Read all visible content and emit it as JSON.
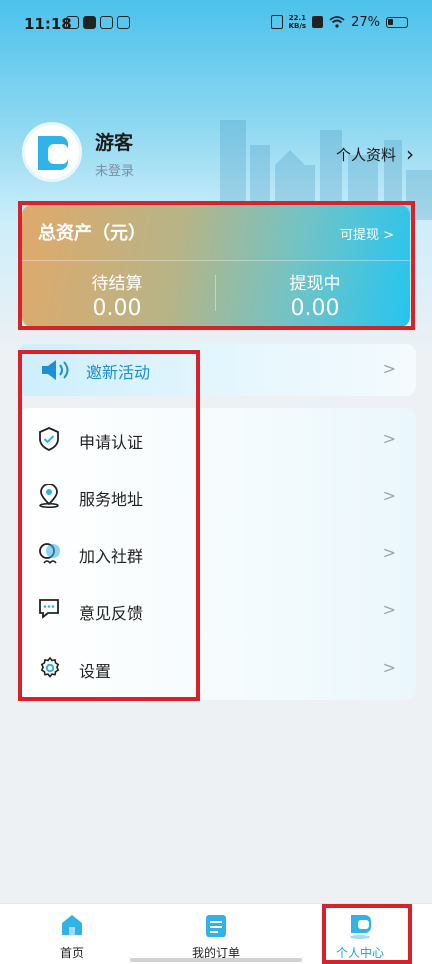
{
  "status_bar": {
    "time": "11:18",
    "net_speed_value": "22.1",
    "net_speed_unit": "KB/s",
    "battery": "27%"
  },
  "profile": {
    "username": "游客",
    "login_status": "未登录",
    "profile_link": "个人资料",
    "chevron": "›"
  },
  "assets": {
    "title": "总资产（元）",
    "withdraw_link": "可提现 >",
    "pending": {
      "label": "待结算",
      "value": "0.00"
    },
    "withdrawing": {
      "label": "提现中",
      "value": "0.00"
    }
  },
  "invite": {
    "label": "邀新活动",
    "icon": "speaker-icon"
  },
  "menu": {
    "items": [
      {
        "label": "申请认证",
        "icon": "shield-check-icon"
      },
      {
        "label": "服务地址",
        "icon": "location-pin-icon"
      },
      {
        "label": "加入社群",
        "icon": "community-icon"
      },
      {
        "label": "意见反馈",
        "icon": "feedback-icon"
      },
      {
        "label": "设置",
        "icon": "settings-gear-icon"
      }
    ]
  },
  "bottom_nav": {
    "items": [
      {
        "label": "首页",
        "icon": "home-icon"
      },
      {
        "label": "我的订单",
        "icon": "orders-icon"
      },
      {
        "label": "个人中心",
        "icon": "profile-icon",
        "active": true
      }
    ]
  },
  "colors": {
    "accent": "#1aa3e0",
    "highlight_box": "#d6222a",
    "invite_text": "#1e8fd0"
  }
}
